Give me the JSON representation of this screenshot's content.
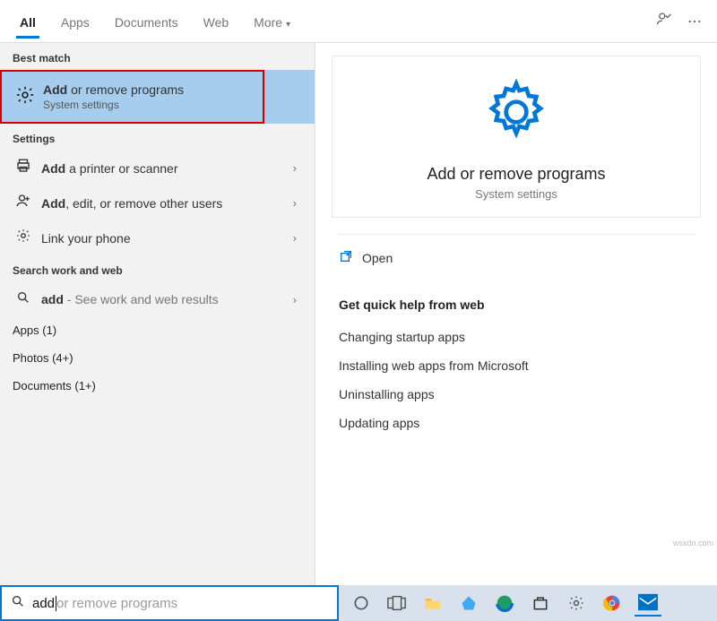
{
  "tabs": {
    "items": [
      "All",
      "Apps",
      "Documents",
      "Web",
      "More"
    ],
    "active": 0
  },
  "sections": {
    "best_match": "Best match",
    "settings": "Settings",
    "search_web": "Search work and web"
  },
  "best": {
    "title_bold": "Add",
    "title_rest": " or remove programs",
    "subtitle": "System settings"
  },
  "settings_items": [
    {
      "bold": "Add",
      "rest": " a printer or scanner",
      "icon": "printer"
    },
    {
      "bold": "Add",
      "rest": ", edit, or remove other users",
      "icon": "user"
    },
    {
      "bold": "",
      "rest": "Link your phone",
      "icon": "gear"
    }
  ],
  "web_item": {
    "bold": "add",
    "rest": " - See work and web results",
    "icon": "search"
  },
  "groups": {
    "apps": "Apps (1)",
    "photos": "Photos (4+)",
    "documents": "Documents (1+)"
  },
  "preview": {
    "title": "Add or remove programs",
    "subtitle": "System settings",
    "open": "Open",
    "help_header": "Get quick help from web",
    "help_links": [
      "Changing startup apps",
      "Installing web apps from Microsoft",
      "Uninstalling apps",
      "Updating apps"
    ]
  },
  "search": {
    "typed": "add",
    "ghost": " or remove programs"
  },
  "watermark": "wsxdn.com"
}
